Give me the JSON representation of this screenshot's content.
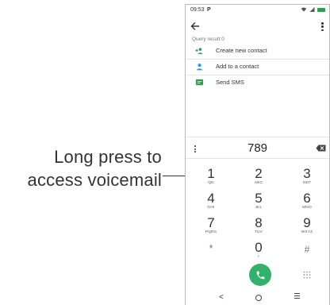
{
  "callout": {
    "line1": "Long press to",
    "line2": "access voicemail"
  },
  "statusbar": {
    "time": "09:53",
    "notification_icon": "P"
  },
  "header": {
    "back_icon": "arrow-left-icon",
    "menu_icon": "more-vert-icon"
  },
  "query_result": "Query result:0",
  "suggestions": [
    {
      "label": "Create new contact",
      "icon": "add-contact-icon",
      "color": "#2e9c4a"
    },
    {
      "label": "Add to a contact",
      "icon": "person-icon",
      "color": "#2196f3"
    },
    {
      "label": "Send SMS",
      "icon": "message-icon",
      "color": "#2e9c4a"
    }
  ],
  "dialed_number": "789",
  "keypad": [
    {
      "digit": "1",
      "letters": "QD"
    },
    {
      "digit": "2",
      "letters": "ABC"
    },
    {
      "digit": "3",
      "letters": "DEF"
    },
    {
      "digit": "4",
      "letters": "GHI"
    },
    {
      "digit": "5",
      "letters": "JKL"
    },
    {
      "digit": "6",
      "letters": "MNO"
    },
    {
      "digit": "7",
      "letters": "PQRS"
    },
    {
      "digit": "8",
      "letters": "TUV"
    },
    {
      "digit": "9",
      "letters": "WXYZ"
    },
    {
      "digit": "*",
      "letters": ""
    },
    {
      "digit": "0",
      "letters": "+"
    },
    {
      "digit": "#",
      "letters": ""
    }
  ],
  "accent_color": "#33b06a",
  "navbar": {
    "back_glyph": "<"
  }
}
